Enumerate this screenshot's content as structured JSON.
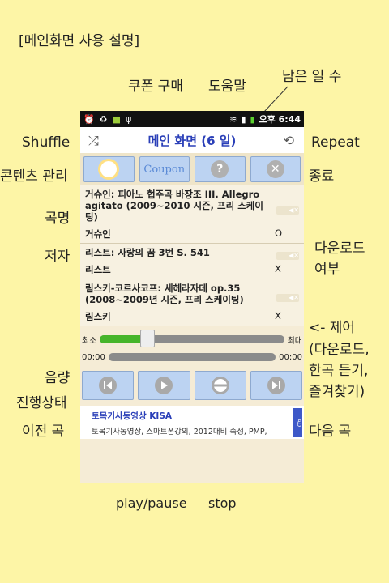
{
  "header_title": "[메인화면 사용 설명]",
  "annotations": {
    "coupon": "쿠폰 구매",
    "help": "도움말",
    "days_left": "남은 일 수",
    "shuffle": "Shuffle",
    "repeat": "Repeat",
    "contents": "콘텐츠 관리",
    "exit": "종료",
    "song_name": "곡명",
    "author": "저자",
    "download_1": "다운로드",
    "download_2": "여부",
    "volume": "음량",
    "progress": "진행상태",
    "control_1": "<- 제어",
    "control_2": "(다운로드,",
    "control_3": "한곡 듣기,",
    "control_4": "즐겨찾기)",
    "prev": "이전 곡",
    "next": "다음 곡",
    "play_pause": "play/pause",
    "stop": "stop"
  },
  "status_bar": {
    "time": "오후 6:44"
  },
  "app": {
    "title": "메인 화면 (6 일)",
    "coupon_label": "Coupon"
  },
  "songs": [
    {
      "title": "거슈인: 피아노 협주곡 바장조 III. Allegro agitato (2009~2010 시즌, 프리 스케이팅)",
      "author": "거슈인",
      "downloaded": "O"
    },
    {
      "title": "리스트: 사랑의 꿈 3번 S. 541",
      "author": "리스트",
      "downloaded": "X"
    },
    {
      "title": "림스키-코르사코프: 세헤라자데 op.35 (2008~2009년 시즌, 프리 스케이팅)",
      "author": "림스키",
      "downloaded": "X"
    }
  ],
  "volume": {
    "min_label": "최소",
    "max_label": "최대",
    "level": 0.26
  },
  "progress": {
    "start": "00:00",
    "end": "00:00",
    "value": 0
  },
  "ad": {
    "title": "토목기사동영상 KISA",
    "text": "토목기사동영상, 스마트폰강의, 2012대비 속성, PMP,",
    "badge": "AD"
  }
}
